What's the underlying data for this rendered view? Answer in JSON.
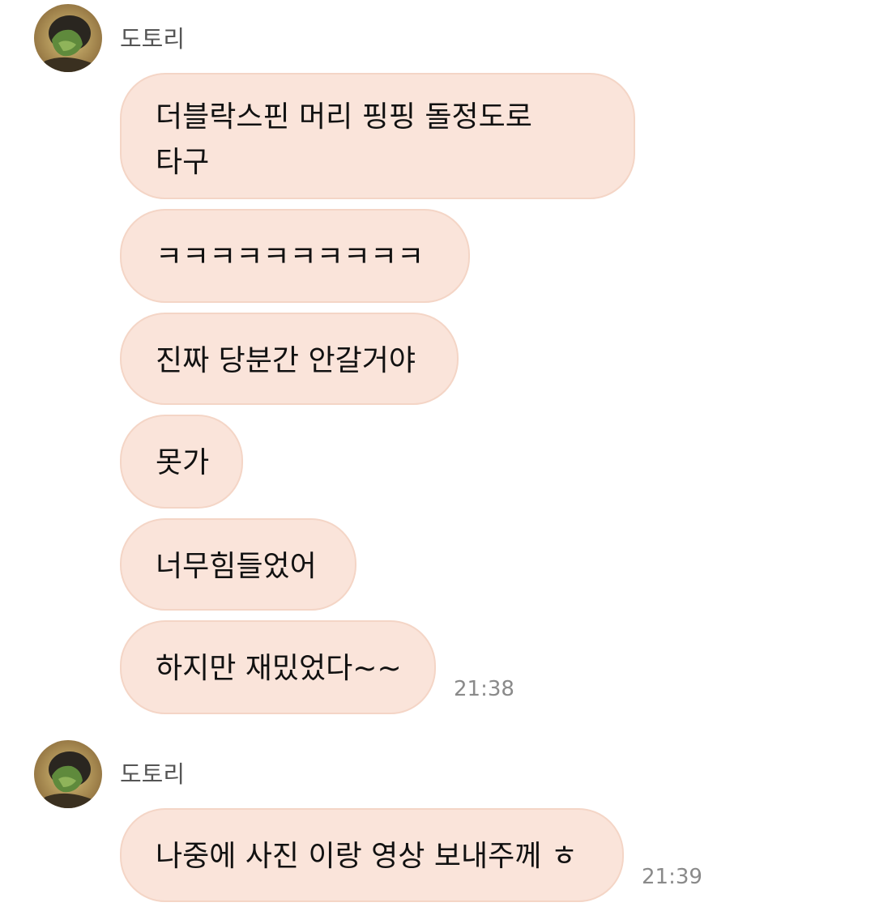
{
  "groups": [
    {
      "sender": {
        "name": "도토리",
        "avatar": "profile-photo"
      },
      "messages": [
        {
          "lines": [
            "더블락스핀 머리 핑핑 돌정도로",
            "타구"
          ]
        },
        {
          "text": "ㅋㅋㅋㅋㅋㅋㅋㅋㅋㅋ"
        },
        {
          "text": "진짜 당분간 안갈거야"
        },
        {
          "text": "못가"
        },
        {
          "text": "너무힘들었어"
        },
        {
          "text": "하지만 재밌었다~~"
        }
      ],
      "time": "21:38"
    },
    {
      "sender": {
        "name": "도토리",
        "avatar": "profile-photo"
      },
      "messages": [
        {
          "text": "나중에 사진 이랑 영상 보내주께 ㅎ"
        }
      ],
      "time": "21:39"
    }
  ],
  "colors": {
    "bubble_fill": "#fae4da",
    "bubble_border": "#f4d5c6",
    "name_text": "#555555",
    "time_text": "#8a8a8a"
  }
}
